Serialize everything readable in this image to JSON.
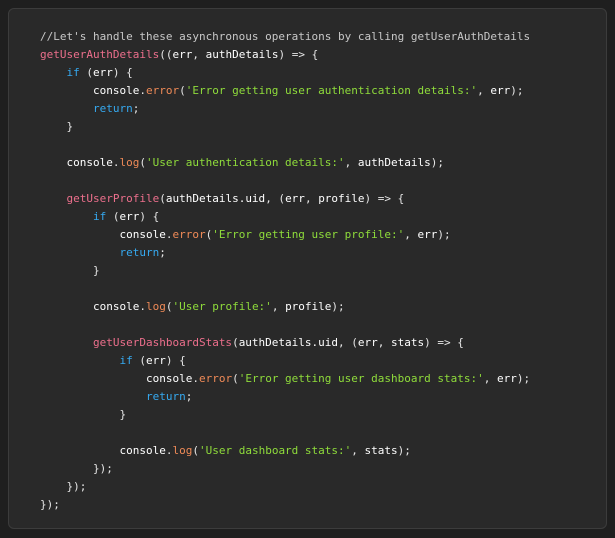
{
  "colors": {
    "background": "#1f1f1f",
    "panel": "#292929",
    "border": "#3c3c3c",
    "comment": "#c8c8c8",
    "function": "#ec6f8c",
    "keyword": "#35a9f0",
    "string": "#8fdc3b",
    "method": "#ef8a57",
    "text": "#e6e6e6"
  },
  "code": {
    "lines": [
      [
        [
          "comment",
          "//Let's handle these asynchronous operations by calling getUserAuthDetails"
        ]
      ],
      [
        [
          "fn",
          "getUserAuthDetails"
        ],
        [
          "punct",
          "(("
        ],
        [
          "ident",
          "err"
        ],
        [
          "punct",
          ", "
        ],
        [
          "ident",
          "authDetails"
        ],
        [
          "punct",
          ") => {"
        ]
      ],
      [
        [
          "punct",
          "    "
        ],
        [
          "kw",
          "if"
        ],
        [
          "punct",
          " ("
        ],
        [
          "ident",
          "err"
        ],
        [
          "punct",
          ") {"
        ]
      ],
      [
        [
          "punct",
          "        "
        ],
        [
          "ident",
          "console"
        ],
        [
          "punct",
          "."
        ],
        [
          "method",
          "error"
        ],
        [
          "punct",
          "("
        ],
        [
          "str",
          "'Error getting user authentication details:'"
        ],
        [
          "punct",
          ", "
        ],
        [
          "ident",
          "err"
        ],
        [
          "punct",
          ");"
        ]
      ],
      [
        [
          "punct",
          "        "
        ],
        [
          "kw",
          "return"
        ],
        [
          "punct",
          ";"
        ]
      ],
      [
        [
          "punct",
          "    }"
        ]
      ],
      [
        [
          "punct",
          ""
        ]
      ],
      [
        [
          "punct",
          "    "
        ],
        [
          "ident",
          "console"
        ],
        [
          "punct",
          "."
        ],
        [
          "method",
          "log"
        ],
        [
          "punct",
          "("
        ],
        [
          "str",
          "'User authentication details:'"
        ],
        [
          "punct",
          ", "
        ],
        [
          "ident",
          "authDetails"
        ],
        [
          "punct",
          ");"
        ]
      ],
      [
        [
          "punct",
          ""
        ]
      ],
      [
        [
          "punct",
          "    "
        ],
        [
          "fn",
          "getUserProfile"
        ],
        [
          "punct",
          "("
        ],
        [
          "ident",
          "authDetails.uid"
        ],
        [
          "punct",
          ", ("
        ],
        [
          "ident",
          "err"
        ],
        [
          "punct",
          ", "
        ],
        [
          "ident",
          "profile"
        ],
        [
          "punct",
          ") => {"
        ]
      ],
      [
        [
          "punct",
          "        "
        ],
        [
          "kw",
          "if"
        ],
        [
          "punct",
          " ("
        ],
        [
          "ident",
          "err"
        ],
        [
          "punct",
          ") {"
        ]
      ],
      [
        [
          "punct",
          "            "
        ],
        [
          "ident",
          "console"
        ],
        [
          "punct",
          "."
        ],
        [
          "method",
          "error"
        ],
        [
          "punct",
          "("
        ],
        [
          "str",
          "'Error getting user profile:'"
        ],
        [
          "punct",
          ", "
        ],
        [
          "ident",
          "err"
        ],
        [
          "punct",
          ");"
        ]
      ],
      [
        [
          "punct",
          "            "
        ],
        [
          "kw",
          "return"
        ],
        [
          "punct",
          ";"
        ]
      ],
      [
        [
          "punct",
          "        }"
        ]
      ],
      [
        [
          "punct",
          ""
        ]
      ],
      [
        [
          "punct",
          "        "
        ],
        [
          "ident",
          "console"
        ],
        [
          "punct",
          "."
        ],
        [
          "method",
          "log"
        ],
        [
          "punct",
          "("
        ],
        [
          "str",
          "'User profile:'"
        ],
        [
          "punct",
          ", "
        ],
        [
          "ident",
          "profile"
        ],
        [
          "punct",
          ");"
        ]
      ],
      [
        [
          "punct",
          ""
        ]
      ],
      [
        [
          "punct",
          "        "
        ],
        [
          "fn",
          "getUserDashboardStats"
        ],
        [
          "punct",
          "("
        ],
        [
          "ident",
          "authDetails.uid"
        ],
        [
          "punct",
          ", ("
        ],
        [
          "ident",
          "err"
        ],
        [
          "punct",
          ", "
        ],
        [
          "ident",
          "stats"
        ],
        [
          "punct",
          ") => {"
        ]
      ],
      [
        [
          "punct",
          "            "
        ],
        [
          "kw",
          "if"
        ],
        [
          "punct",
          " ("
        ],
        [
          "ident",
          "err"
        ],
        [
          "punct",
          ") {"
        ]
      ],
      [
        [
          "punct",
          "                "
        ],
        [
          "ident",
          "console"
        ],
        [
          "punct",
          "."
        ],
        [
          "method",
          "error"
        ],
        [
          "punct",
          "("
        ],
        [
          "str",
          "'Error getting user dashboard stats:'"
        ],
        [
          "punct",
          ", "
        ],
        [
          "ident",
          "err"
        ],
        [
          "punct",
          ");"
        ]
      ],
      [
        [
          "punct",
          "                "
        ],
        [
          "kw",
          "return"
        ],
        [
          "punct",
          ";"
        ]
      ],
      [
        [
          "punct",
          "            }"
        ]
      ],
      [
        [
          "punct",
          ""
        ]
      ],
      [
        [
          "punct",
          "            "
        ],
        [
          "ident",
          "console"
        ],
        [
          "punct",
          "."
        ],
        [
          "method",
          "log"
        ],
        [
          "punct",
          "("
        ],
        [
          "str",
          "'User dashboard stats:'"
        ],
        [
          "punct",
          ", "
        ],
        [
          "ident",
          "stats"
        ],
        [
          "punct",
          ");"
        ]
      ],
      [
        [
          "punct",
          "        });"
        ]
      ],
      [
        [
          "punct",
          "    });"
        ]
      ],
      [
        [
          "punct",
          "});"
        ]
      ]
    ]
  }
}
